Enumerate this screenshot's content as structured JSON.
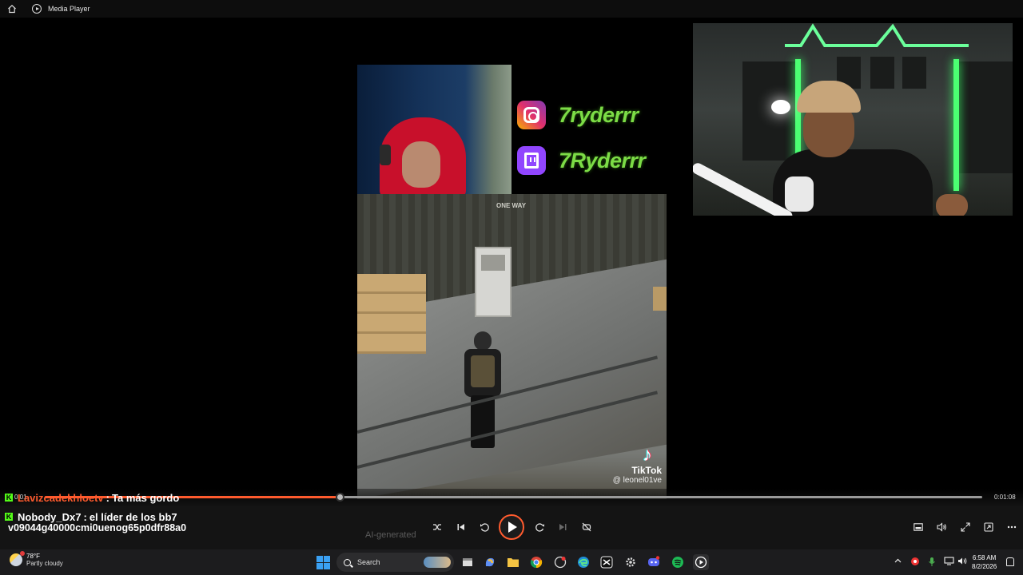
{
  "window": {
    "title": "Media Player"
  },
  "video": {
    "social": {
      "instagram_handle": "7ryderrr",
      "twitch_handle": "7Ryderrr"
    },
    "game_sign": "ONE WAY",
    "tiktok": {
      "wordmark": "TikTok",
      "user": "@ leonel01ve"
    }
  },
  "chat": {
    "line1": {
      "user": "Lavizcadekhloetv",
      "sep": ":",
      "text": "Ta más gordo"
    },
    "line2": {
      "user": "Nobody_Dx7",
      "sep": ":",
      "text": "el líder de los bb7"
    },
    "line3": "v09044g40000cmi0uenog65p0dfr88a0"
  },
  "player": {
    "current_time": "0:01",
    "total_time": "0:01:08",
    "progress": 0.315,
    "ai_label": "AI-generated",
    "accent_color": "#ff5b2e",
    "controls": [
      "shuffle-icon",
      "previous-icon",
      "rewind-10-icon",
      "play-icon",
      "forward-30-icon",
      "next-icon",
      "repeat-off-icon"
    ],
    "right_controls": [
      "miniplayer-icon",
      "volume-icon",
      "fullscreen-icon",
      "cast-icon",
      "more-icon"
    ]
  },
  "taskbar": {
    "weather_temp": "78°F",
    "weather_cond": "Partly cloudy",
    "search_placeholder": "Search",
    "time": "6:58 AM",
    "date": "8/2/2026"
  }
}
